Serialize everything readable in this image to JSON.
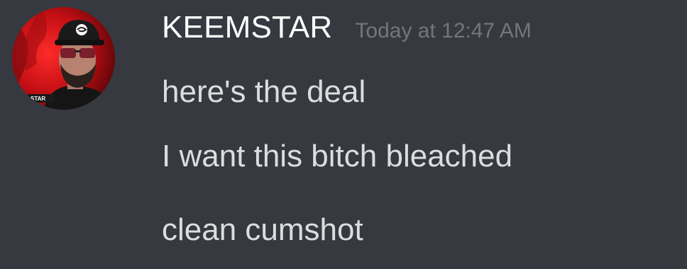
{
  "message": {
    "avatar_icon": "user-avatar-photo",
    "avatar_badge_text": "STAR",
    "username": "KEEMSTAR",
    "timestamp": "Today at 12:47 AM",
    "lines": [
      "here's the deal",
      "I want this bitch bleached",
      "clean cumshot"
    ]
  },
  "colors": {
    "background": "#36393f",
    "username": "#ffffff",
    "timestamp": "#72767d",
    "message_text": "#dcddde",
    "avatar_red": "#d4141a"
  }
}
